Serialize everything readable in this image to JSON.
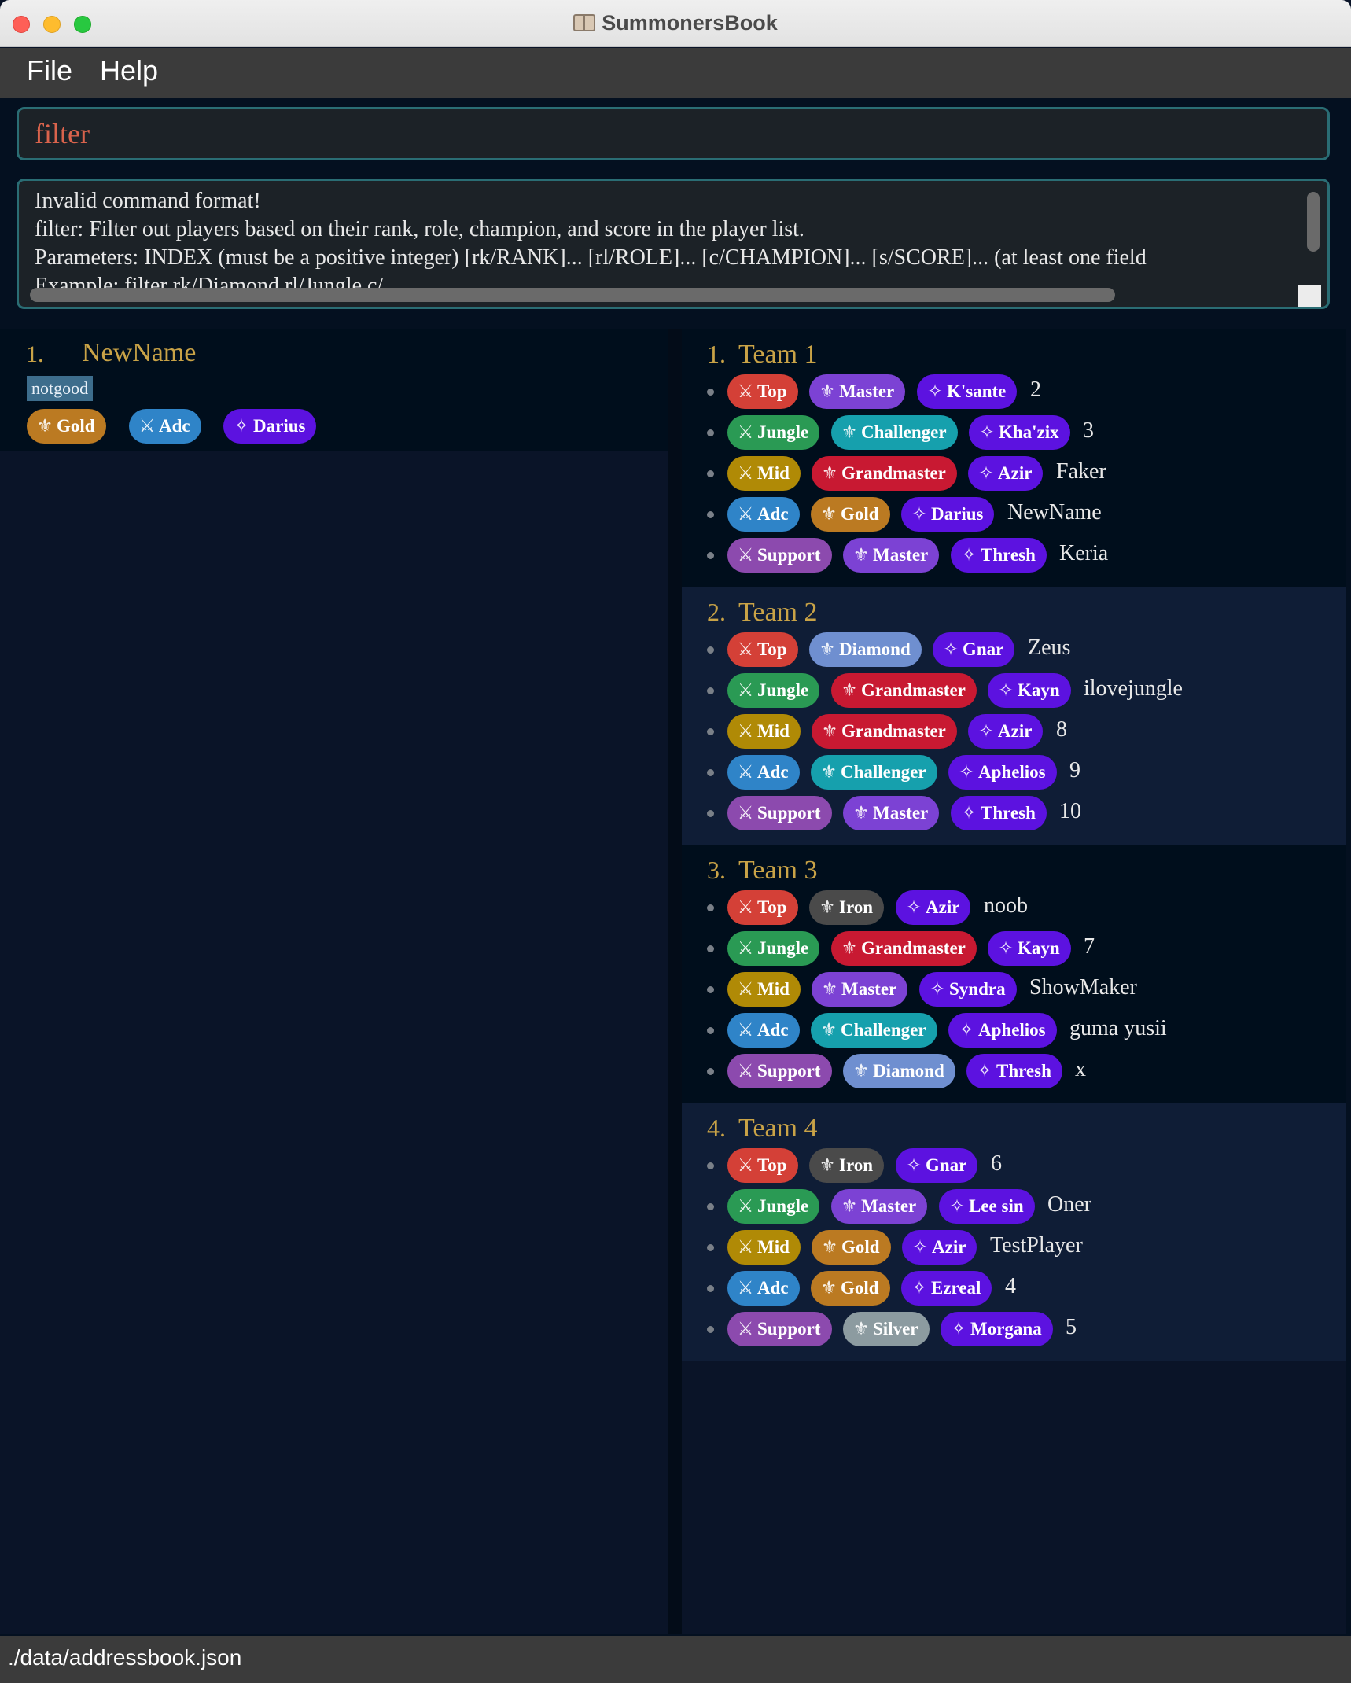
{
  "window": {
    "title": "SummonersBook"
  },
  "menu": {
    "file": "File",
    "help": "Help"
  },
  "command": {
    "value": "filter"
  },
  "result": {
    "lines": [
      "Invalid command format!",
      "filter: Filter out players based on their rank, role, champion, and score in the player list.",
      "Parameters: INDEX (must be a positive integer) [rk/RANK]... [rl/ROLE]... [c/CHAMPION]... [s/SCORE]... (at least one field",
      "Example: filter rk/Diamond rl/Jungle c/..."
    ]
  },
  "colors": {
    "role": {
      "Top": "#d44037",
      "Jungle": "#2a9a54",
      "Mid": "#b08a06",
      "Adc": "#2f84c8",
      "Support": "#8c4aae"
    },
    "rank": {
      "Iron": "#4a4a4a",
      "Silver": "#8c9ba0",
      "Gold": "#bb7a22",
      "Diamond": "#6f8fd0",
      "Master": "#7c42d4",
      "Grandmaster": "#c81932",
      "Challenger": "#16a0ad"
    },
    "champion": "#5c12e0",
    "accent": "#c9a347"
  },
  "icons": {
    "role": "crossed-swords-icon",
    "rank": "fleur-de-lis-icon",
    "champion": "sparkle-icon"
  },
  "player": {
    "index": "1.",
    "name": "NewName",
    "tag": "notgood",
    "rank": "Gold",
    "role": "Adc",
    "champion": "Darius"
  },
  "teams": [
    {
      "index": "1.",
      "name": "Team 1",
      "members": [
        {
          "role": "Top",
          "rank": "Master",
          "champion": "K'sante",
          "name": "2"
        },
        {
          "role": "Jungle",
          "rank": "Challenger",
          "champion": "Kha'zix",
          "name": "3"
        },
        {
          "role": "Mid",
          "rank": "Grandmaster",
          "champion": "Azir",
          "name": "Faker"
        },
        {
          "role": "Adc",
          "rank": "Gold",
          "champion": "Darius",
          "name": "NewName"
        },
        {
          "role": "Support",
          "rank": "Master",
          "champion": "Thresh",
          "name": "Keria"
        }
      ]
    },
    {
      "index": "2.",
      "name": "Team 2",
      "members": [
        {
          "role": "Top",
          "rank": "Diamond",
          "champion": "Gnar",
          "name": "Zeus"
        },
        {
          "role": "Jungle",
          "rank": "Grandmaster",
          "champion": "Kayn",
          "name": "ilovejungle"
        },
        {
          "role": "Mid",
          "rank": "Grandmaster",
          "champion": "Azir",
          "name": "8"
        },
        {
          "role": "Adc",
          "rank": "Challenger",
          "champion": "Aphelios",
          "name": "9"
        },
        {
          "role": "Support",
          "rank": "Master",
          "champion": "Thresh",
          "name": "10"
        }
      ]
    },
    {
      "index": "3.",
      "name": "Team 3",
      "members": [
        {
          "role": "Top",
          "rank": "Iron",
          "champion": "Azir",
          "name": "noob"
        },
        {
          "role": "Jungle",
          "rank": "Grandmaster",
          "champion": "Kayn",
          "name": "7"
        },
        {
          "role": "Mid",
          "rank": "Master",
          "champion": "Syndra",
          "name": "ShowMaker"
        },
        {
          "role": "Adc",
          "rank": "Challenger",
          "champion": "Aphelios",
          "name": "guma yusii"
        },
        {
          "role": "Support",
          "rank": "Diamond",
          "champion": "Thresh",
          "name": "x"
        }
      ]
    },
    {
      "index": "4.",
      "name": "Team 4",
      "members": [
        {
          "role": "Top",
          "rank": "Iron",
          "champion": "Gnar",
          "name": "6"
        },
        {
          "role": "Jungle",
          "rank": "Master",
          "champion": "Lee sin",
          "name": "Oner"
        },
        {
          "role": "Mid",
          "rank": "Gold",
          "champion": "Azir",
          "name": "TestPlayer"
        },
        {
          "role": "Adc",
          "rank": "Gold",
          "champion": "Ezreal",
          "name": "4"
        },
        {
          "role": "Support",
          "rank": "Silver",
          "champion": "Morgana",
          "name": "5"
        }
      ]
    }
  ],
  "status": {
    "path": "./data/addressbook.json"
  }
}
